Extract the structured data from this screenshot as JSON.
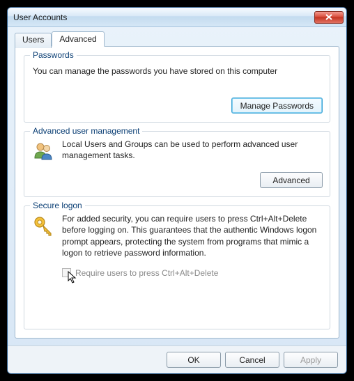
{
  "window": {
    "title": "User Accounts"
  },
  "tabs": {
    "users": "Users",
    "advanced": "Advanced"
  },
  "passwords": {
    "label": "Passwords",
    "text": "You can manage the passwords you have stored on this computer",
    "button": "Manage Passwords"
  },
  "aum": {
    "label": "Advanced user management",
    "text": "Local Users and Groups can be used to perform advanced user management tasks.",
    "button": "Advanced"
  },
  "secure": {
    "label": "Secure logon",
    "text": "For added security, you can require users to press Ctrl+Alt+Delete before logging on. This guarantees that the authentic Windows logon prompt appears, protecting the system from programs that mimic a logon to retrieve password information.",
    "checkbox": "Require users to press Ctrl+Alt+Delete"
  },
  "buttons": {
    "ok": "OK",
    "cancel": "Cancel",
    "apply": "Apply"
  }
}
